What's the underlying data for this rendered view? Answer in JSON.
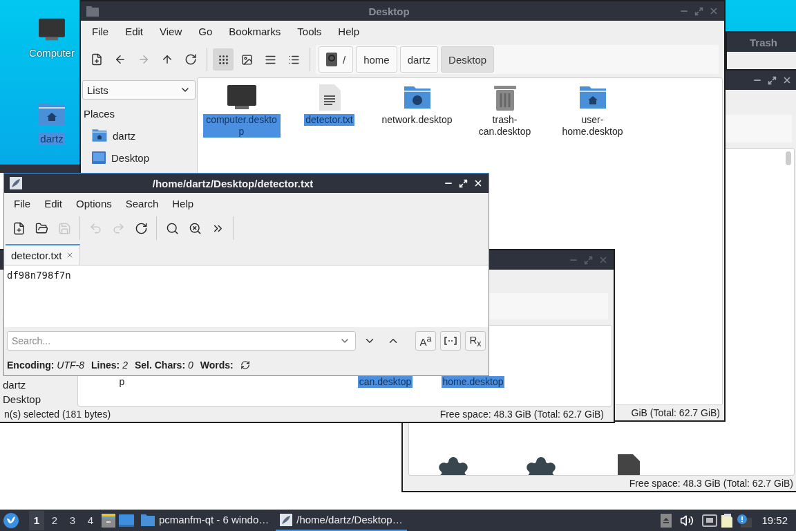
{
  "desktop_icons": [
    {
      "label": "Computer",
      "kind": "computer",
      "selected": false
    },
    {
      "label": "dartz",
      "kind": "home",
      "selected": true
    }
  ],
  "back_window": {
    "status": "Free space: 48.3 GiB (Total: 62.7 GiB)"
  },
  "trash_window": {
    "title": "Trash"
  },
  "file_manager": {
    "title": "Desktop",
    "menu": [
      "File",
      "Edit",
      "View",
      "Go",
      "Bookmarks",
      "Tools",
      "Help"
    ],
    "view_modes": [
      {
        "kind": "icons",
        "selected": true
      },
      {
        "kind": "thumbnails",
        "selected": false
      },
      {
        "kind": "compact",
        "selected": false
      },
      {
        "kind": "details",
        "selected": false
      }
    ],
    "path": [
      {
        "label": "/",
        "kind": "root",
        "selected": false
      },
      {
        "label": "home",
        "kind": "dir",
        "selected": false
      },
      {
        "label": "dartz",
        "kind": "dir",
        "selected": false
      },
      {
        "label": "Desktop",
        "kind": "dir",
        "selected": true
      }
    ],
    "side_pane_mode": "Lists",
    "places_heading": "Places",
    "places": [
      {
        "label": "dartz",
        "kind": "home"
      },
      {
        "label": "Desktop",
        "kind": "desktop"
      }
    ],
    "files": [
      {
        "name": "computer.desktop",
        "kind": "computer",
        "selected": true
      },
      {
        "name": "detector.txt",
        "kind": "text",
        "selected": true
      },
      {
        "name": "network.desktop",
        "kind": "network",
        "selected": false
      },
      {
        "name": "trash-can.desktop",
        "kind": "trash",
        "selected": false
      },
      {
        "name": "user-home.desktop",
        "kind": "home",
        "selected": false
      }
    ],
    "status": "GiB (Total: 62.7 GiB)"
  },
  "second_file_manager": {
    "places": [
      "dartz",
      "Desktop"
    ],
    "files": [
      {
        "name": "p",
        "selected": false
      },
      {
        "name": "can.desktop",
        "selected": true
      },
      {
        "name": "home.desktop",
        "selected": true
      }
    ],
    "status_left": "n(s) selected (181 bytes)",
    "status_right": "Free space: 48.3 GiB (Total: 62.7 GiB)"
  },
  "editor": {
    "title": "/home/dartz/Desktop/detector.txt",
    "menu": [
      "File",
      "Edit",
      "Options",
      "Search",
      "Help"
    ],
    "toolbar": [
      {
        "kind": "new",
        "disabled": false
      },
      {
        "kind": "open",
        "disabled": false
      },
      {
        "kind": "save",
        "disabled": true
      },
      {
        "kind": "sep"
      },
      {
        "kind": "undo",
        "disabled": true
      },
      {
        "kind": "redo",
        "disabled": true
      },
      {
        "kind": "reload",
        "disabled": false
      },
      {
        "kind": "sep"
      },
      {
        "kind": "find",
        "disabled": false
      },
      {
        "kind": "replace",
        "disabled": false
      },
      {
        "kind": "more",
        "disabled": false
      },
      {
        "kind": "sep"
      }
    ],
    "tabs": [
      {
        "label": "detector.txt",
        "selected": true
      }
    ],
    "text": "df98n798f7n",
    "search": {
      "placeholder": "Search..."
    },
    "search_options": [
      {
        "kind": "text",
        "label": "A$^{a}$"
      },
      {
        "kind": "whole-word"
      },
      {
        "kind": "text",
        "label": "R$_{x}$"
      }
    ],
    "status": [
      {
        "label": "Encoding:",
        "value": "UTF-8"
      },
      {
        "label": "Lines:",
        "value": "2"
      },
      {
        "label": "Sel. Chars:",
        "value": "0"
      },
      {
        "label": "Words:"
      }
    ]
  },
  "taskbar": {
    "workspaces": [
      {
        "label": "1",
        "selected": true
      },
      {
        "label": "2",
        "selected": false
      },
      {
        "label": "3",
        "selected": false
      },
      {
        "label": "4",
        "selected": false
      }
    ],
    "tasks": [
      {
        "label": "pcmanfm-qt - 6 windo…",
        "kind": "folder",
        "selected": false
      },
      {
        "label": "/home/dartz/Desktop…",
        "kind": "editor",
        "selected": true
      }
    ],
    "clock": "19:52"
  }
}
